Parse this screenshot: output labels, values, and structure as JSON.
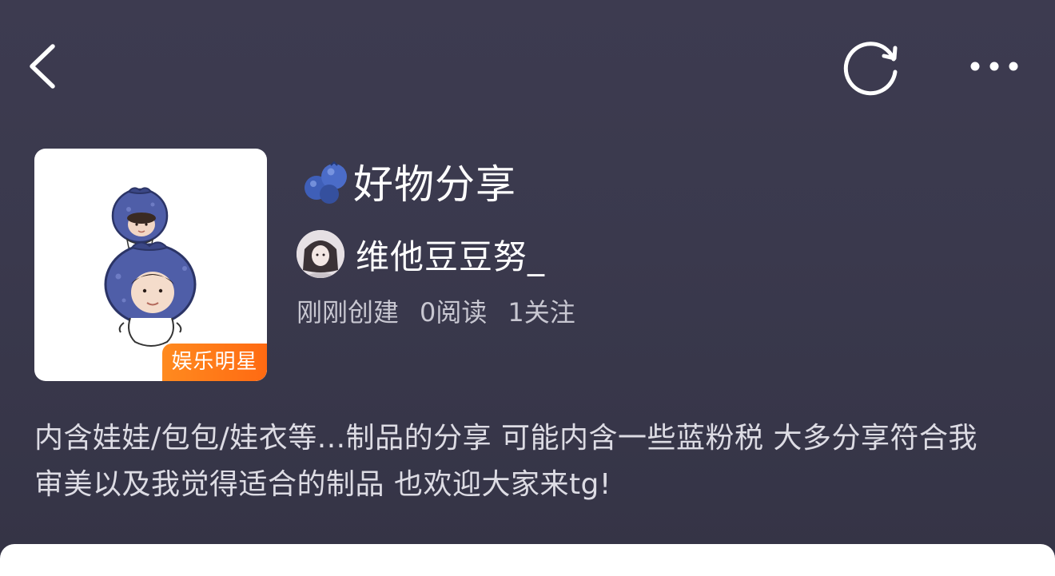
{
  "nav": {
    "back_icon": "chevron-left-icon",
    "refresh_icon": "refresh-icon",
    "more_icon": "more-horizontal-icon"
  },
  "collection": {
    "category_badge": "娱乐明星",
    "title_emoji": "blueberries-emoji",
    "title": "好物分享",
    "author": "维他豆豆努_",
    "stats": {
      "created": "刚刚创建",
      "reads": "0阅读",
      "follows": "1关注"
    },
    "description": "内含娃娃/包包/娃衣等...制品的分享 可能内含一些蓝粉税 大多分享符合我审美以及我觉得适合的制品 也欢迎大家来tg!"
  },
  "colors": {
    "background": "#3a394d",
    "badge": "#ff7a18",
    "text_primary": "#ffffff",
    "text_secondary": "#c8c7d1"
  }
}
